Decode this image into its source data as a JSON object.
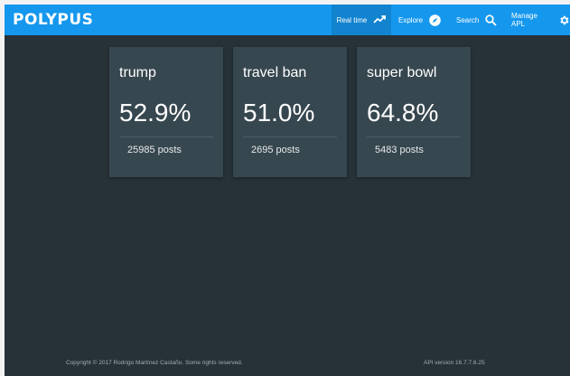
{
  "app": {
    "logo": "POLYPUS"
  },
  "nav": {
    "realtime": "Real time",
    "explore": "Explore",
    "search": "Search",
    "manage": "Manage APL"
  },
  "cards": [
    {
      "topic": "trump",
      "percent": "52.9%",
      "posts": "25985 posts"
    },
    {
      "topic": "travel ban",
      "percent": "51.0%",
      "posts": "2695 posts"
    },
    {
      "topic": "super bowl",
      "percent": "64.8%",
      "posts": "5483 posts"
    }
  ],
  "footer": {
    "copyright": "Copyright © 2017 Rodrigo Martínez Castaño. Some rights reserved.",
    "api_version": "API version 16.7.7.6.25"
  },
  "colors": {
    "navbar": "#1597ee",
    "background": "#263238",
    "card": "#37474f"
  },
  "icons": [
    "trending-up-icon",
    "compass-icon",
    "search-icon",
    "gear-icon"
  ]
}
